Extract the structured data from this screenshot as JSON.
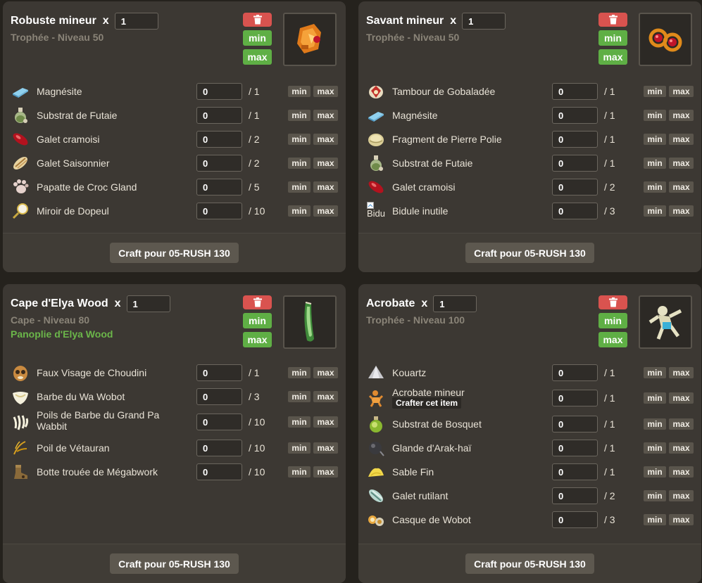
{
  "cards": [
    {
      "title": "Robuste mineur",
      "x_label": "x",
      "quantity": "1",
      "subtitle": "Trophée - Niveau 50",
      "buttons": {
        "min": "min",
        "max": "max"
      },
      "item_icon": "orange-gem-trophy-icon",
      "resources": [
        {
          "name": "Magnésite",
          "value": "0",
          "total": "/ 1",
          "icon": "blue-ingot-icon"
        },
        {
          "name": "Substrat de Futaie",
          "value": "0",
          "total": "/ 1",
          "icon": "potion-bottle-icon"
        },
        {
          "name": "Galet cramoisi",
          "value": "0",
          "total": "/ 2",
          "icon": "red-pebble-icon"
        },
        {
          "name": "Galet Saisonnier",
          "value": "0",
          "total": "/ 2",
          "icon": "striped-pebble-icon"
        },
        {
          "name": "Papatte de Croc Gland",
          "value": "0",
          "total": "/ 5",
          "icon": "paw-icon"
        },
        {
          "name": "Miroir de Dopeul",
          "value": "0",
          "total": "/ 10",
          "icon": "mirror-icon"
        }
      ],
      "craft_label": "Craft pour 05-RUSH 130"
    },
    {
      "title": "Savant mineur",
      "x_label": "x",
      "quantity": "1",
      "subtitle": "Trophée - Niveau 50",
      "buttons": {
        "min": "min",
        "max": "max"
      },
      "item_icon": "red-orb-goggles-icon",
      "resources": [
        {
          "name": "Tambour de Gobaladée",
          "value": "0",
          "total": "/ 1",
          "icon": "drum-icon"
        },
        {
          "name": "Magnésite",
          "value": "0",
          "total": "/ 1",
          "icon": "blue-ingot-icon"
        },
        {
          "name": "Fragment de Pierre Polie",
          "value": "0",
          "total": "/ 1",
          "icon": "stone-fragment-icon"
        },
        {
          "name": "Substrat de Futaie",
          "value": "0",
          "total": "/ 1",
          "icon": "potion-bottle-icon"
        },
        {
          "name": "Galet cramoisi",
          "value": "0",
          "total": "/ 2",
          "icon": "red-pebble-icon"
        },
        {
          "name": "Bidule inutile",
          "value": "0",
          "total": "/ 3",
          "icon": "broken-image-icon",
          "icon_alt": "Bidu"
        }
      ],
      "craft_label": "Craft pour 05-RUSH 130"
    },
    {
      "title": "Cape d'Elya Wood",
      "x_label": "x",
      "quantity": "1",
      "subtitle": "Cape - Niveau 80",
      "set_name": "Panoplie d'Elya Wood",
      "buttons": {
        "min": "min",
        "max": "max"
      },
      "item_icon": "green-cape-icon",
      "resources": [
        {
          "name": "Faux Visage de Choudini",
          "value": "0",
          "total": "/ 1",
          "icon": "mask-icon"
        },
        {
          "name": "Barbe du Wa Wobot",
          "value": "0",
          "total": "/ 3",
          "icon": "beard-icon"
        },
        {
          "name": "Poils de Barbe du Grand Pa Wabbit",
          "value": "0",
          "total": "/ 10",
          "icon": "beard-hair-icon"
        },
        {
          "name": "Poil de Vétauran",
          "value": "0",
          "total": "/ 10",
          "icon": "hair-strand-icon"
        },
        {
          "name": "Botte trouée de Mégabwork",
          "value": "0",
          "total": "/ 10",
          "icon": "boot-icon"
        }
      ],
      "craft_label": "Craft pour 05-RUSH 130"
    },
    {
      "title": "Acrobate",
      "x_label": "x",
      "quantity": "1",
      "subtitle": "Trophée - Niveau 100",
      "buttons": {
        "min": "min",
        "max": "max"
      },
      "item_icon": "acrobat-figure-icon",
      "resources": [
        {
          "name": "Kouartz",
          "value": "0",
          "total": "/ 1",
          "icon": "quartz-icon"
        },
        {
          "name": "Acrobate mineur",
          "value": "0",
          "total": "/ 1",
          "icon": "acrobat-small-icon",
          "craft_tag": "Crafter cet item"
        },
        {
          "name": "Substrat de Bosquet",
          "value": "0",
          "total": "/ 1",
          "icon": "green-potion-icon"
        },
        {
          "name": "Glande d'Arak-haï",
          "value": "0",
          "total": "/ 1",
          "icon": "dark-gland-icon"
        },
        {
          "name": "Sable Fin",
          "value": "0",
          "total": "/ 1",
          "icon": "sand-pile-icon"
        },
        {
          "name": "Galet rutilant",
          "value": "0",
          "total": "/ 2",
          "icon": "shiny-pebble-icon"
        },
        {
          "name": "Casque de Wobot",
          "value": "0",
          "total": "/ 3",
          "icon": "helmet-icon"
        }
      ],
      "craft_label": "Craft pour 05-RUSH 130"
    }
  ],
  "row_buttons": {
    "min": "min",
    "max": "max"
  }
}
